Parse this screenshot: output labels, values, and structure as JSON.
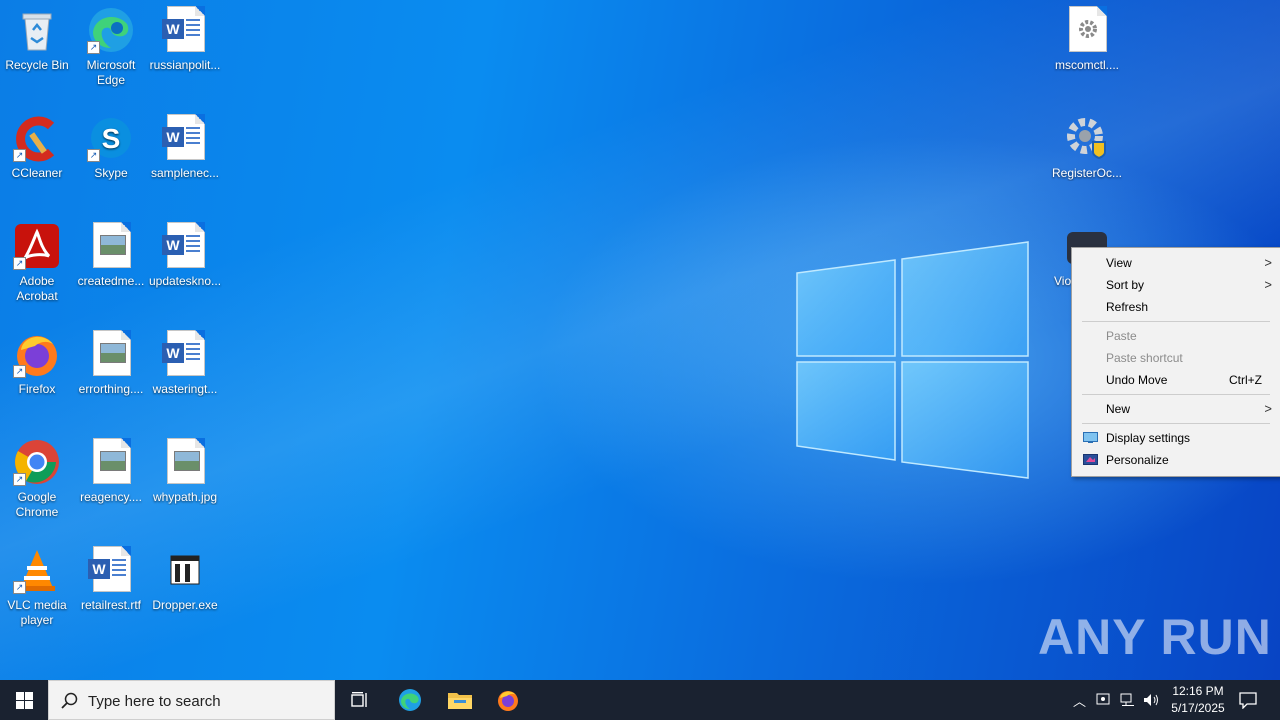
{
  "desktop": {
    "icons": [
      {
        "label": "Recycle Bin",
        "icon": "recycle-bin-icon"
      },
      {
        "label": "Microsoft",
        "label2": "Edge",
        "icon": "edge-icon"
      },
      {
        "label": "russianpolit...",
        "icon": "word-doc-icon"
      },
      {
        "label": "CCleaner",
        "icon": "ccleaner-icon"
      },
      {
        "label": "Skype",
        "icon": "skype-icon"
      },
      {
        "label": "samplenec...",
        "icon": "word-doc-icon"
      },
      {
        "label": "Adobe",
        "label2": "Acrobat",
        "icon": "acrobat-icon"
      },
      {
        "label": "createdme...",
        "icon": "image-file-icon"
      },
      {
        "label": "updateskno...",
        "icon": "word-doc-icon"
      },
      {
        "label": "Firefox",
        "icon": "firefox-icon"
      },
      {
        "label": "errorthing....",
        "icon": "image-file-icon"
      },
      {
        "label": "wasteringt...",
        "icon": "word-doc-icon"
      },
      {
        "label": "Google",
        "label2": "Chrome",
        "icon": "chrome-icon"
      },
      {
        "label": "reagency....",
        "icon": "image-file-icon"
      },
      {
        "label": "whypath.jpg",
        "icon": "image-file-icon"
      },
      {
        "label": "VLC media",
        "label2": "player",
        "icon": "vlc-icon"
      },
      {
        "label": "retailrest.rtf",
        "icon": "word-doc-icon"
      },
      {
        "label": "Dropper.exe",
        "icon": "exe-file-icon"
      },
      {
        "label": "mscomctl....",
        "icon": "settings-file-icon"
      },
      {
        "label": "RegisterOc...",
        "icon": "register-settings-icon"
      },
      {
        "label": "Vio",
        "icon": "app-icon"
      }
    ]
  },
  "context_menu": {
    "view": "View",
    "sort_by": "Sort by",
    "refresh": "Refresh",
    "paste": "Paste",
    "paste_shortcut": "Paste shortcut",
    "undo_move": "Undo Move",
    "undo_shortcut": "Ctrl+Z",
    "new": "New",
    "display_settings": "Display settings",
    "personalize": "Personalize"
  },
  "taskbar": {
    "search_placeholder": "Type here to search",
    "time": "12:16 PM",
    "date": "5/17/2025"
  },
  "watermark": "ANY RUN",
  "colors": {
    "desktop": "#0a6fe0",
    "taskbar": "#1a2230",
    "menu_bg": "#f2f2f2"
  }
}
